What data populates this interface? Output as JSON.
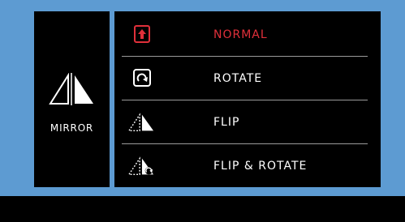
{
  "colors": {
    "background": "#5d9bd2",
    "panel": "#000000",
    "text": "#ffffff",
    "selected": "#e0303a",
    "divider": "#9a9a9a"
  },
  "side": {
    "icon": "mirror-icon",
    "label": "MIRROR"
  },
  "menu": {
    "selected_index": 0,
    "items": [
      {
        "label": "NORMAL",
        "icon": "arrow-up-box-icon",
        "selected": true
      },
      {
        "label": "ROTATE",
        "icon": "rotate-box-icon",
        "selected": false
      },
      {
        "label": "FLIP",
        "icon": "flip-triangles-icon",
        "selected": false
      },
      {
        "label": "FLIP & ROTATE",
        "icon": "flip-rotate-triangles-icon",
        "selected": false
      }
    ]
  }
}
